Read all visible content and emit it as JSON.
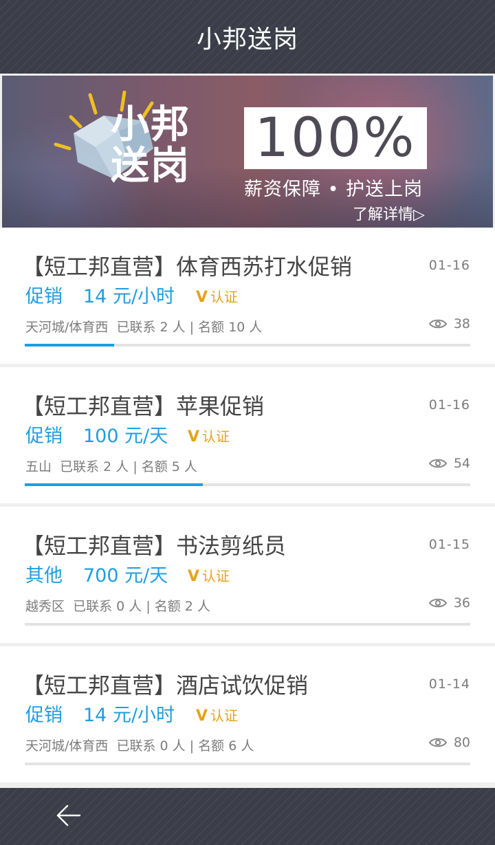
{
  "header": {
    "title": "小邦送岗"
  },
  "banner": {
    "logo_line1": "小邦",
    "logo_line2": "送岗",
    "percentage": "100%",
    "slogan": "薪资保障 • 护送上岗",
    "more_link": "了解详情▷"
  },
  "jobs": [
    {
      "title": "【短工邦直营】体育西苏打水促销",
      "date": "01-16",
      "category": "促销",
      "salary": "14 元/小时",
      "verified_mark": "V",
      "verified_label": "认证",
      "location": "天河城/体育西",
      "contacted": "已联系 2 人",
      "quota": "名额 10 人",
      "views": "38",
      "fill_fraction": 0.2
    },
    {
      "title": "【短工邦直营】苹果促销",
      "date": "01-16",
      "category": "促销",
      "salary": "100 元/天",
      "verified_mark": "V",
      "verified_label": "认证",
      "location": "五山",
      "contacted": "已联系 2 人",
      "quota": "名额 5 人",
      "views": "54",
      "fill_fraction": 0.4
    },
    {
      "title": "【短工邦直营】书法剪纸员",
      "date": "01-15",
      "category": "其他",
      "salary": "700 元/天",
      "verified_mark": "V",
      "verified_label": "认证",
      "location": "越秀区",
      "contacted": "已联系 0 人",
      "quota": "名额 2 人",
      "views": "36",
      "fill_fraction": 0
    },
    {
      "title": "【短工邦直营】酒店试饮促销",
      "date": "01-14",
      "category": "促销",
      "salary": "14 元/小时",
      "verified_mark": "V",
      "verified_label": "认证",
      "location": "天河城/体育西",
      "contacted": "已联系 0 人",
      "quota": "名额 6 人",
      "views": "80",
      "fill_fraction": 0
    }
  ],
  "footer": {
    "back_icon": "arrow-left-icon"
  },
  "colors": {
    "accent": "#1f9de0",
    "verified": "#e6a21a",
    "bar": "#3b3e48"
  }
}
